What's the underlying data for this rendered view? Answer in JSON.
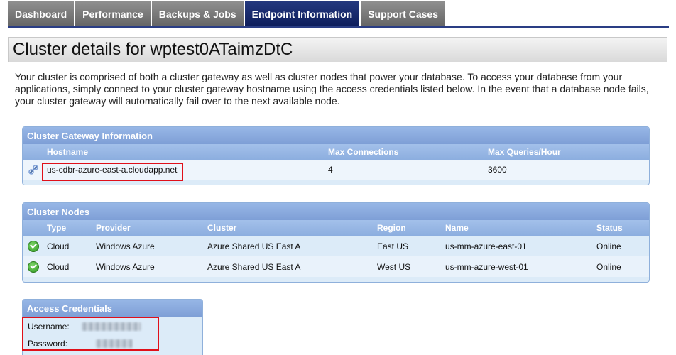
{
  "tabs": [
    {
      "label": "Dashboard",
      "active": false
    },
    {
      "label": "Performance",
      "active": false
    },
    {
      "label": "Backups & Jobs",
      "active": false
    },
    {
      "label": "Endpoint Information",
      "active": true
    },
    {
      "label": "Support Cases",
      "active": false
    }
  ],
  "page": {
    "title": "Cluster details for wptest0ATaimzDtC",
    "intro": "Your cluster is comprised of both a cluster gateway as well as cluster nodes that power your database. To access your database from your applications, simply connect to your cluster gateway hostname using the access credentials listed below. In the event that a database node fails, your cluster gateway will automatically fail over to the next available node."
  },
  "gateway": {
    "heading": "Cluster Gateway Information",
    "columns": {
      "hostname": "Hostname",
      "max_connections": "Max Connections",
      "max_queries": "Max Queries/Hour"
    },
    "row": {
      "hostname": "us-cdbr-azure-east-a.cloudapp.net",
      "max_connections": "4",
      "max_queries": "3600",
      "icon": "link-icon"
    }
  },
  "nodes": {
    "heading": "Cluster Nodes",
    "columns": {
      "type": "Type",
      "provider": "Provider",
      "cluster": "Cluster",
      "region": "Region",
      "name": "Name",
      "status": "Status"
    },
    "rows": [
      {
        "type": "Cloud",
        "provider": "Windows Azure",
        "cluster": "Azure Shared US East A",
        "region": "East US",
        "name": "us-mm-azure-east-01",
        "status": "Online",
        "icon": "check-icon"
      },
      {
        "type": "Cloud",
        "provider": "Windows Azure",
        "cluster": "Azure Shared US East A",
        "region": "West US",
        "name": "us-mm-azure-west-01",
        "status": "Online",
        "icon": "check-icon"
      }
    ]
  },
  "credentials": {
    "heading": "Access Credentials",
    "username_label": "Username:",
    "password_label": "Password:"
  },
  "colors": {
    "active_tab": "#0d1d5b",
    "inactive_tab": "#707070",
    "panel_header": "#7e9fd6",
    "panel_body": "#dcebf8",
    "highlight": "#e0101a",
    "status_online": "#2f9a20"
  }
}
